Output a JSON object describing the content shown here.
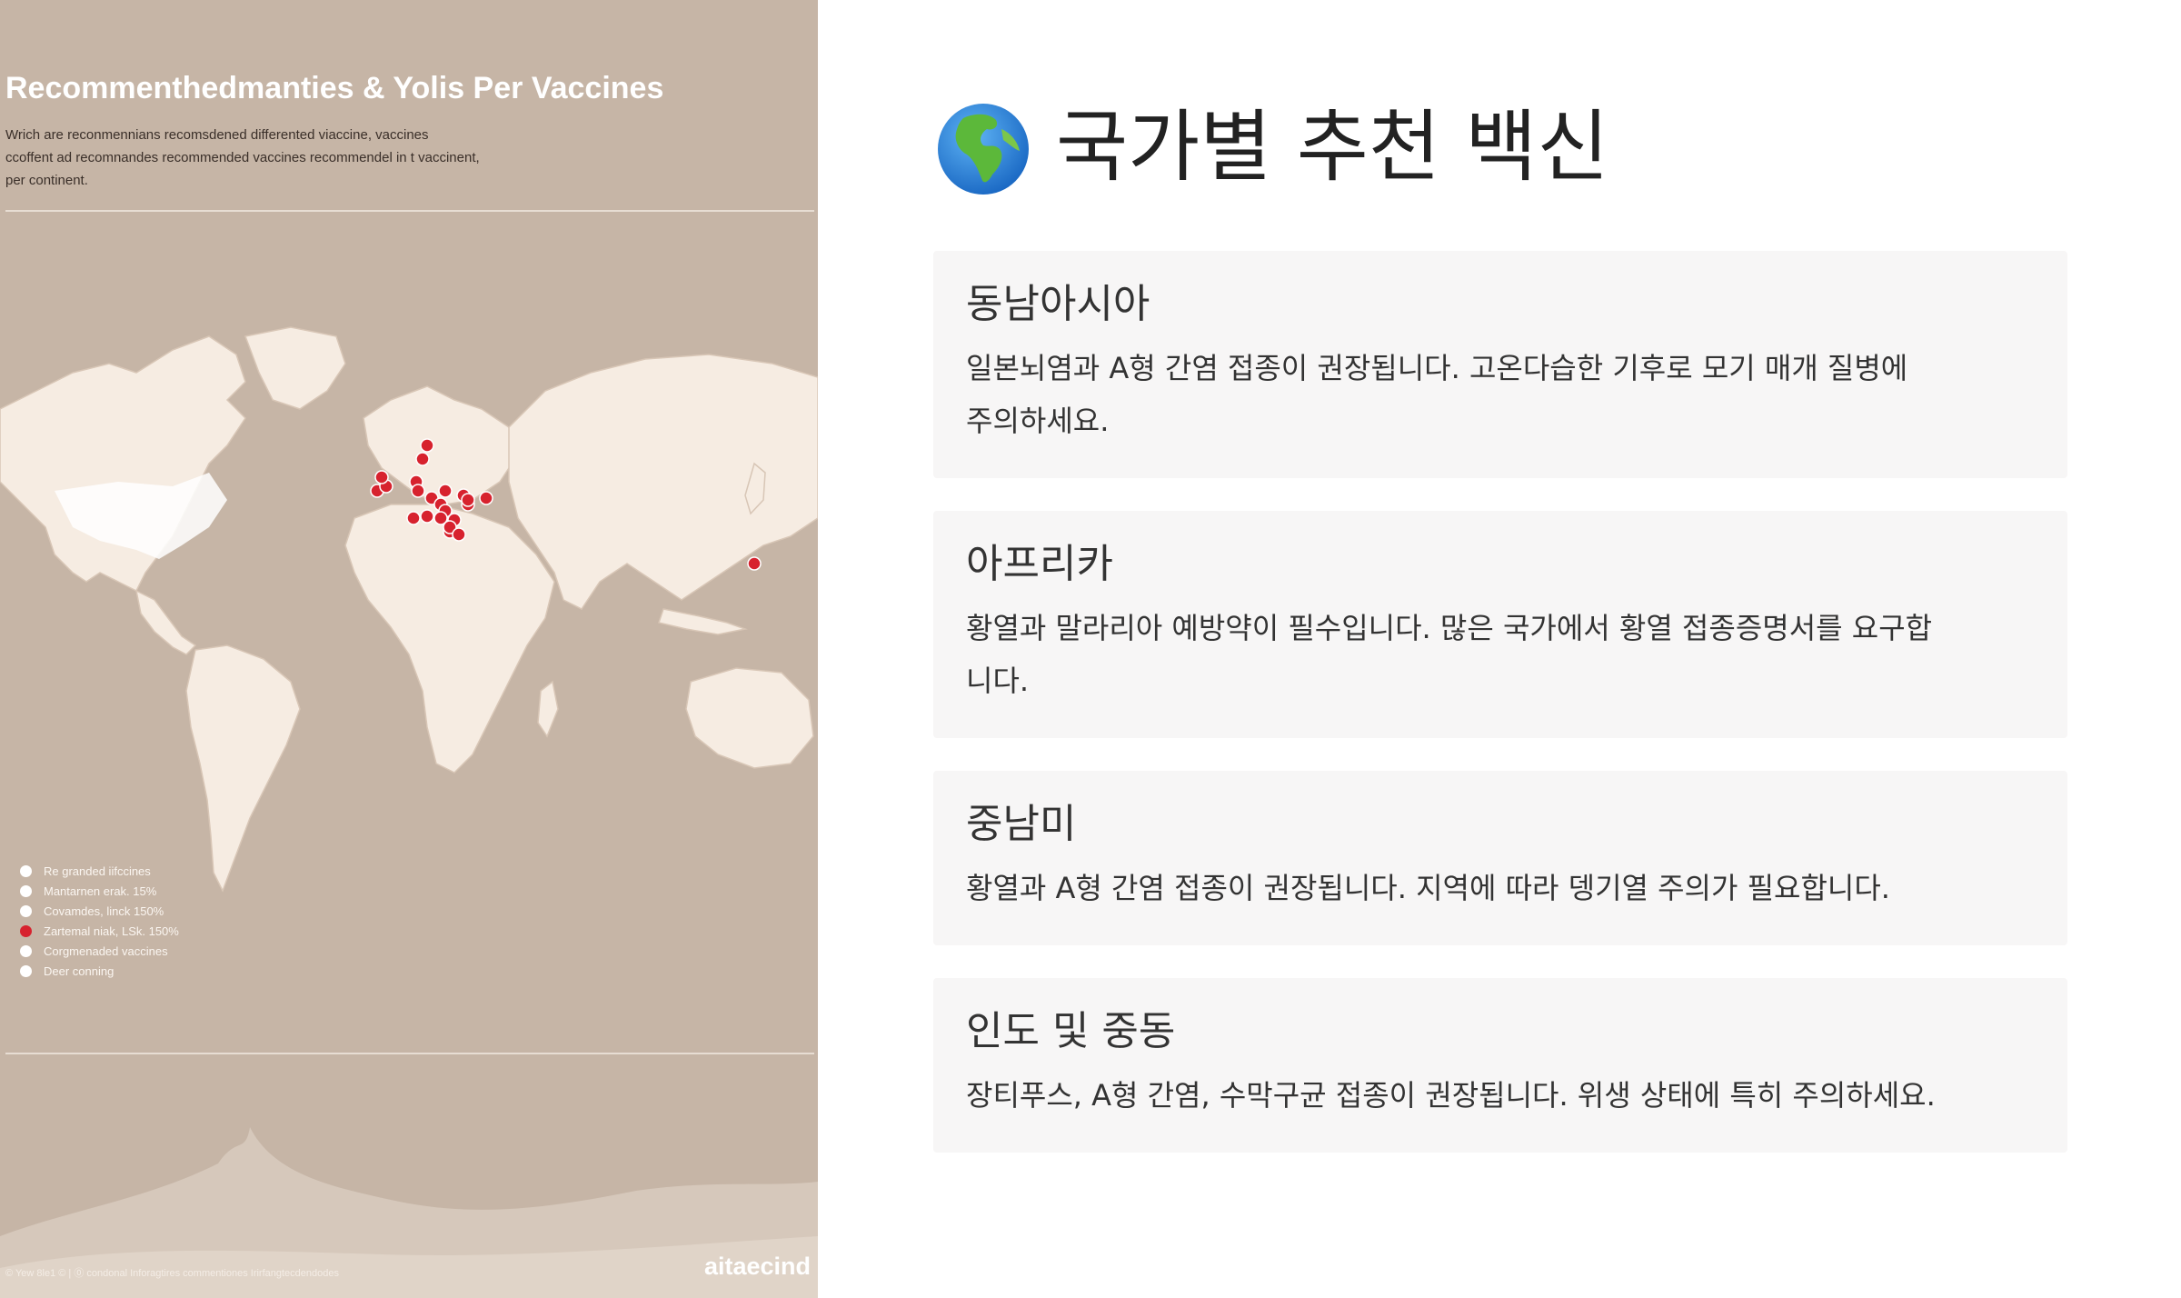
{
  "infographic": {
    "title": "Recommenthedmanties & Yolis Per Vaccines",
    "description_lines": [
      "Wrich are reconmennians recomsdened differented viaccine, vaccines",
      "ccoffent ad recomnandes recommended vaccines recommendel in t vaccinent,",
      "per continent."
    ],
    "legend": [
      {
        "label": "Re granded iifccines",
        "color": "#ffffff"
      },
      {
        "label": "Mantarnen erak. 15%",
        "color": "#ffffff"
      },
      {
        "label": "Covamdes, linck 150%",
        "color": "#ffffff"
      },
      {
        "label": "Zartemal niak, LSk. 150%",
        "color": "#d7222e"
      },
      {
        "label": "Corgmenaded vaccines",
        "color": "#ffffff"
      },
      {
        "label": "Deer conning",
        "color": "#ffffff"
      }
    ],
    "footnote": "© Yew 8le1 © | ⓪ condonal Inforagtires commentiones Irirfangtecdendodes",
    "brand": "aitaecind",
    "map_marker_color": "#d7222e"
  },
  "page": {
    "title": "국가별 추천 백신",
    "title_icon": "globe-icon"
  },
  "regions": [
    {
      "name": "동남아시아",
      "text_lines": [
        "일본뇌염과 A형 간염 접종이 권장됩니다. 고온다습한 기후로 모기 매개 질병에",
        "주의하세요."
      ]
    },
    {
      "name": "아프리카",
      "text_lines": [
        "황열과 말라리아 예방약이 필수입니다. 많은 국가에서 황열 접종증명서를 요구합",
        "니다."
      ]
    },
    {
      "name": "중남미",
      "text_lines": [
        "황열과 A형 간염 접종이 권장됩니다. 지역에 따라 뎅기열 주의가 필요합니다."
      ]
    },
    {
      "name": "인도 및 중동",
      "text_lines": [
        "장티푸스, A형 간염, 수막구균 접종이 권장됩니다. 위생 상태에 특히 주의하세요."
      ]
    }
  ]
}
